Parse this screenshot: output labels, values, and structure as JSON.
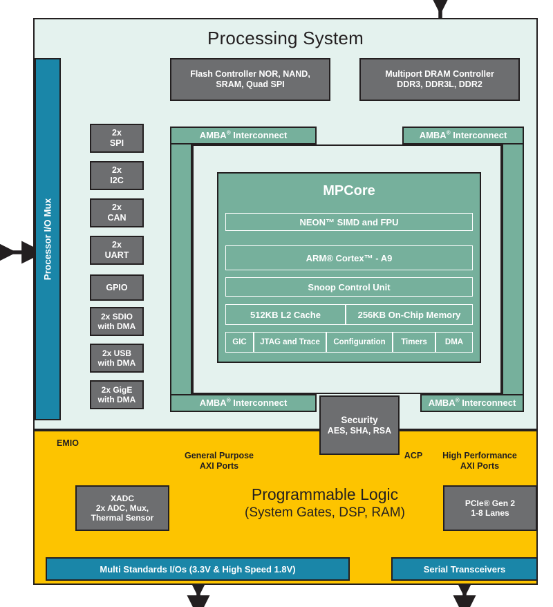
{
  "diagram": {
    "title": "Zynq All Programmable SoC Block Diagram",
    "colors": {
      "processing_system_bg": "#e4f2ee",
      "programmable_logic_bg": "#fdc400",
      "interconnect_green": "#76b09c",
      "io_teal": "#1a86a8",
      "block_gray": "#6d6e70",
      "outline": "#231f20",
      "text_dark": "#231f20",
      "text_light": "#ffffff"
    }
  },
  "processing_system": {
    "title": "Processing System",
    "io_mux": {
      "label": "Processor I/O Mux"
    },
    "memory_controllers": [
      {
        "name": "flash-controller",
        "line1": "Flash Controller NOR, NAND,",
        "line2": "SRAM, Quad SPI"
      },
      {
        "name": "dram-controller",
        "line1": "Multiport DRAM Controller",
        "line2": "DDR3, DDR3L, DDR2"
      }
    ],
    "peripherals": [
      {
        "name": "spi",
        "line1": "2x",
        "line2": "SPI"
      },
      {
        "name": "i2c",
        "line1": "2x",
        "line2": "I2C"
      },
      {
        "name": "can",
        "line1": "2x",
        "line2": "CAN"
      },
      {
        "name": "uart",
        "line1": "2x",
        "line2": "UART"
      },
      {
        "name": "gpio",
        "line1": "GPIO",
        "line2": ""
      },
      {
        "name": "sdio",
        "line1": "2x SDIO",
        "line2": "with DMA"
      },
      {
        "name": "usb",
        "line1": "2x USB",
        "line2": "with DMA"
      },
      {
        "name": "gige",
        "line1": "2x GigE",
        "line2": "with DMA"
      }
    ],
    "interconnects": [
      {
        "name": "amba-top-left",
        "label": "AMBA",
        "suffix": "Interconnect",
        "reg": "®"
      },
      {
        "name": "amba-top-right",
        "label": "AMBA",
        "suffix": "Interconnect",
        "reg": "®"
      },
      {
        "name": "amba-bottom-left",
        "label": "AMBA",
        "suffix": "Interconnect",
        "reg": "®"
      },
      {
        "name": "amba-bottom-right",
        "label": "AMBA",
        "suffix": "Interconnect",
        "reg": "®"
      }
    ],
    "mpcore": {
      "title": "MPCore",
      "neon": "NEON™ SIMD and FPU",
      "cpu": "ARM® Cortex™ - A9",
      "scu": "Snoop Control Unit",
      "memory": [
        {
          "name": "l2-cache",
          "label": "512KB L2 Cache"
        },
        {
          "name": "on-chip-memory",
          "label": "256KB On-Chip Memory"
        }
      ],
      "peripherals": [
        {
          "name": "gic",
          "label": "GIC"
        },
        {
          "name": "jtag-trace",
          "label": "JTAG and Trace"
        },
        {
          "name": "configuration",
          "label": "Configuration"
        },
        {
          "name": "timers",
          "label": "Timers"
        },
        {
          "name": "dma",
          "label": "DMA"
        }
      ]
    },
    "security": {
      "line1": "Security",
      "line2": "AES, SHA, RSA"
    }
  },
  "programmable_logic": {
    "title_line1": "Programmable Logic",
    "title_line2": "(System Gates, DSP, RAM)",
    "port_labels": [
      {
        "name": "emio",
        "line1": "EMIO",
        "line2": ""
      },
      {
        "name": "general-purpose-axi",
        "line1": "General Purpose",
        "line2": "AXI Ports"
      },
      {
        "name": "acp",
        "line1": "ACP",
        "line2": ""
      },
      {
        "name": "high-performance-axi",
        "line1": "High Performance",
        "line2": "AXI Ports"
      }
    ],
    "blocks": [
      {
        "name": "xadc",
        "line1": "XADC",
        "line2": "2x ADC, Mux,",
        "line3": "Thermal Sensor"
      },
      {
        "name": "pcie",
        "line1": "PCIe® Gen 2",
        "line2": "1-8 Lanes",
        "line3": ""
      }
    ],
    "io_bars": [
      {
        "name": "multi-standards-io",
        "label": "Multi Standards I/Os (3.3V & High Speed 1.8V)"
      },
      {
        "name": "serial-transceivers",
        "label": "Serial Transceivers"
      }
    ]
  }
}
